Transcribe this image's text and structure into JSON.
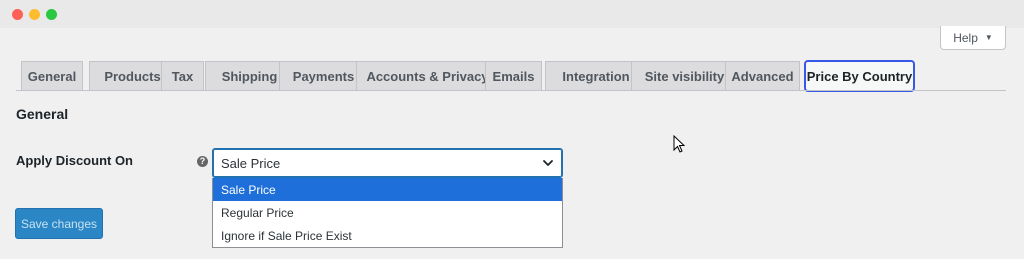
{
  "window": {
    "controls": [
      "close",
      "minimize",
      "maximize"
    ]
  },
  "header": {
    "help_label": "Help",
    "help_icon": "caret-down-icon"
  },
  "tabs": [
    {
      "label": "General"
    },
    {
      "label": "Products"
    },
    {
      "label": "Tax"
    },
    {
      "label": "Shipping"
    },
    {
      "label": "Payments"
    },
    {
      "label": "Accounts & Privacy"
    },
    {
      "label": "Emails"
    },
    {
      "label": "Integration"
    },
    {
      "label": "Site visibility"
    },
    {
      "label": "Advanced"
    },
    {
      "label": "Price By Country",
      "active": true
    }
  ],
  "section": {
    "title": "General"
  },
  "field": {
    "label": "Apply Discount On",
    "help_icon": "question-circle-icon",
    "selected_value": "Sale Price",
    "options": [
      "Sale Price",
      "Regular Price",
      "Ignore if Sale Price Exist"
    ],
    "highlighted_option": "Sale Price"
  },
  "actions": {
    "save_label": "Save changes"
  },
  "colors": {
    "accent": "#2271b1",
    "active_tab_border": "#3858e9",
    "highlight": "#1e6fd9"
  }
}
